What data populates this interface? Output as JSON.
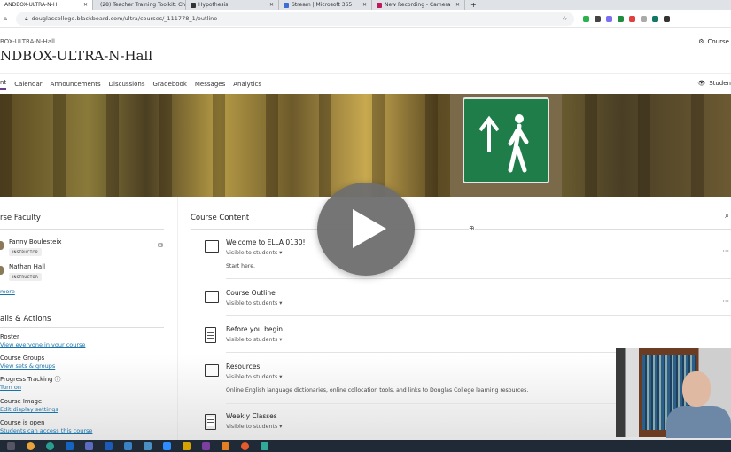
{
  "browser": {
    "tabs": [
      {
        "label": "ANDBOX-ULTRA-N-H",
        "active": true
      },
      {
        "label": "(28) Teacher Training Toolkit: Ch"
      },
      {
        "label": "Hypothesis"
      },
      {
        "label": "Stream | Microsoft 365"
      },
      {
        "label": "New Recording - Camera"
      }
    ],
    "new_tab": "+",
    "url": "douglascollege.blackboard.com/ultra/courses/_111778_1/outline"
  },
  "header": {
    "breadcrumb": "BOX-ULTRA-N-Hall",
    "title": "NDBOX-ULTRA-N-Hall",
    "settings_label": "Course"
  },
  "nav": {
    "items": [
      "nt",
      "Calendar",
      "Announcements",
      "Discussions",
      "Gradebook",
      "Messages",
      "Analytics"
    ],
    "student_preview": "Studen"
  },
  "faculty": {
    "heading": "rse Faculty",
    "people": [
      {
        "name": "Fanny Boulesteix",
        "role": "INSTRUCTOR"
      },
      {
        "name": "Nathan Hall",
        "role": "INSTRUCTOR"
      }
    ],
    "more": "more"
  },
  "details": {
    "heading": "ails & Actions",
    "items": [
      {
        "label": "Roster",
        "link": "View everyone in your course"
      },
      {
        "label": "Course Groups",
        "link": "View sets & groups"
      },
      {
        "label": "Progress Tracking",
        "link": "Turn on"
      },
      {
        "label": "Course Image",
        "link": "Edit display settings"
      },
      {
        "label": "Course is open",
        "link": "Students can access this course"
      }
    ]
  },
  "content": {
    "heading": "Course Content",
    "items": [
      {
        "title": "Welcome to ELLA 0130!",
        "visibility": "Visible to students ▾",
        "desc": "Start here.",
        "icon": "folder"
      },
      {
        "title": "Course Outline",
        "visibility": "Visible to students ▾",
        "desc": "",
        "icon": "folder"
      },
      {
        "title": "Before you begin",
        "visibility": "Visible to students ▾",
        "desc": "",
        "icon": "document"
      },
      {
        "title": "Resources",
        "visibility": "Visible to students ▾",
        "desc": "Online English language dictionaries, online collocation tools, and links to Douglas College learning resources.",
        "icon": "folder"
      },
      {
        "title": "Weekly Classes",
        "visibility": "Visible to students ▾",
        "desc": "",
        "icon": "document"
      }
    ]
  }
}
